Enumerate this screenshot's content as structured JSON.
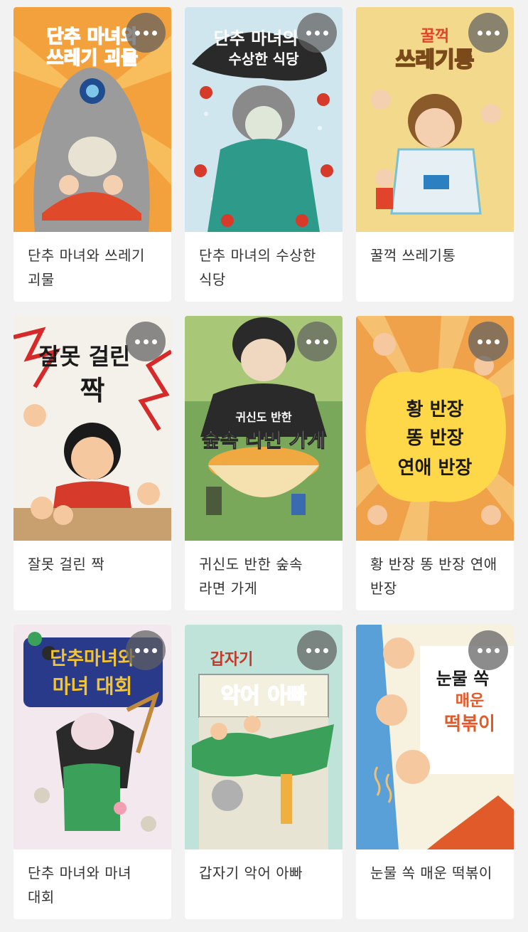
{
  "books": [
    {
      "title": "단추 마녀와 쓰레기 괴물",
      "cover_text": [
        "단추 마녀와",
        "쓰레기 괴물"
      ],
      "colors": {
        "bg": "#f3a13c",
        "accent": "#e04a2a",
        "ink": "#2c5fb0",
        "fig": "#9b9b9b"
      }
    },
    {
      "title": "단추 마녀의 수상한 식당",
      "cover_text": [
        "단추 마녀의",
        "수상한 식당"
      ],
      "colors": {
        "bg": "#cfe6ee",
        "accent": "#d63a2a",
        "ink": "#2a2a2a",
        "fig": "#2e9a8a"
      }
    },
    {
      "title": "꿀꺽 쓰레기통",
      "cover_text": [
        "꿀꺽",
        "쓰레기통"
      ],
      "colors": {
        "bg": "#f1d27a",
        "accent": "#e0452b",
        "ink": "#7a4a1a",
        "fig": "#7ac0d6"
      }
    },
    {
      "title": "잘못 걸린 짝",
      "cover_text": [
        "잘못 걸린",
        "짝"
      ],
      "colors": {
        "bg": "#f4f1ea",
        "accent": "#d62a2a",
        "ink": "#1a1a1a",
        "fig": "#3a6ab0"
      }
    },
    {
      "title": "귀신도 반한 숲속 라면 가게",
      "cover_text": [
        "귀신도 반한",
        "숲속 라면 가게"
      ],
      "colors": {
        "bg": "#7aa85a",
        "accent": "#e8b04a",
        "ink": "#ffffff",
        "fig": "#2a2a2a"
      }
    },
    {
      "title": "황 반장 똥 반장 연애 반장",
      "cover_text": [
        "황 반장",
        "똥 반장",
        "연애 반장"
      ],
      "colors": {
        "bg": "#f0a24a",
        "accent": "#ffd84a",
        "ink": "#1a1a1a",
        "fig": "#c0392b"
      }
    },
    {
      "title": "단추 마녀와 마녀 대회",
      "cover_text": [
        "단추마녀와",
        "마녀 대회"
      ],
      "colors": {
        "bg": "#f3e8ee",
        "accent": "#f3c432",
        "ink": "#2a3a8a",
        "fig": "#3aa05a"
      }
    },
    {
      "title": "갑자기 악어 아빠",
      "cover_text": [
        "갑자기",
        "악어 아빠"
      ],
      "colors": {
        "bg": "#bfe3d8",
        "accent": "#e24a2a",
        "ink": "#c0392b",
        "fig": "#3aa05a"
      }
    },
    {
      "title": "눈물 쏙 매운 떡볶이",
      "cover_text": [
        "눈물 쏙",
        "매운",
        "떡볶이"
      ],
      "colors": {
        "bg": "#f7f1e0",
        "accent": "#e05a2a",
        "ink": "#1a1a1a",
        "fig": "#5aa0d8"
      }
    }
  ]
}
